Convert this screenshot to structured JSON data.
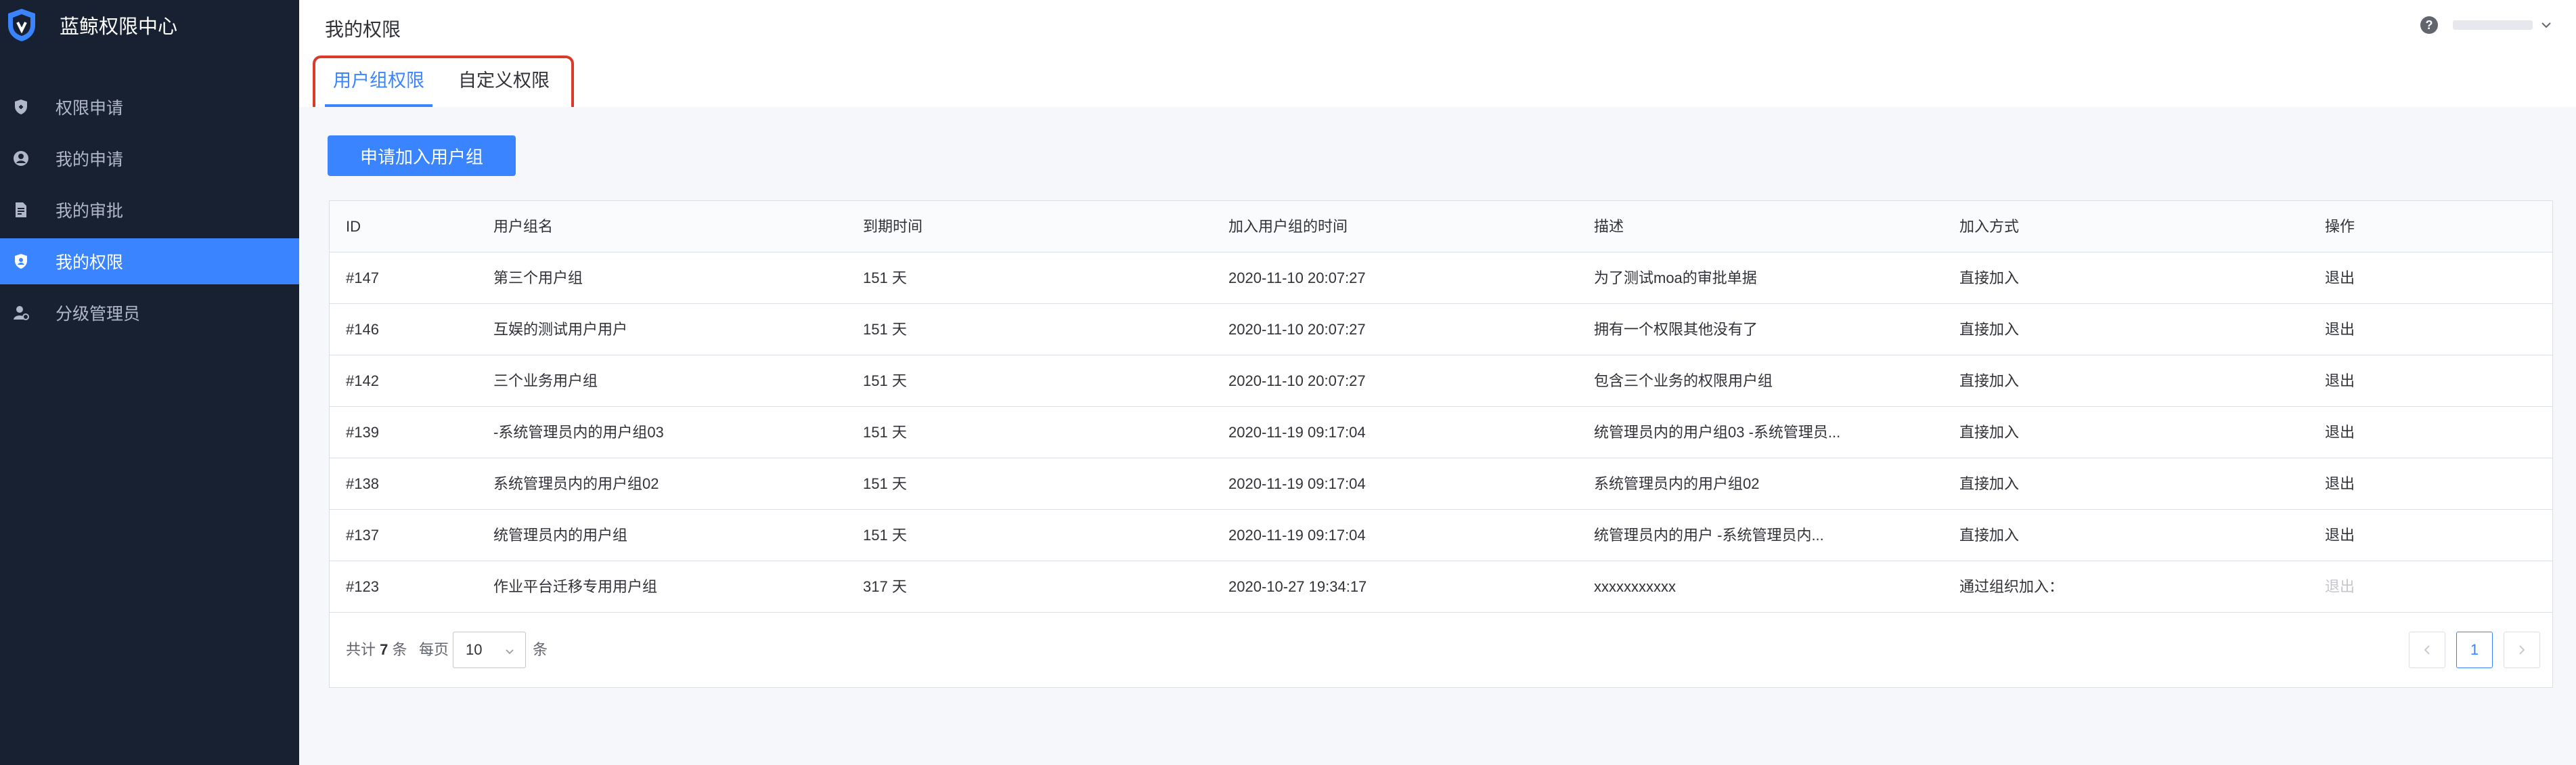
{
  "app": {
    "title": "蓝鲸权限中心"
  },
  "sidebar": {
    "items": [
      {
        "label": "权限申请",
        "icon": "shield-add-icon"
      },
      {
        "label": "我的申请",
        "icon": "user-circle-icon"
      },
      {
        "label": "我的审批",
        "icon": "document-icon"
      },
      {
        "label": "我的权限",
        "icon": "shield-user-icon",
        "active": true
      },
      {
        "label": "分级管理员",
        "icon": "admin-user-icon"
      }
    ]
  },
  "header": {
    "page_title": "我的权限",
    "help": "?"
  },
  "tabs": [
    {
      "label": "用户组权限",
      "active": true
    },
    {
      "label": "自定义权限",
      "active": false
    }
  ],
  "actions": {
    "apply_button": "申请加入用户组"
  },
  "table": {
    "columns": [
      "ID",
      "用户组名",
      "到期时间",
      "加入用户组的时间",
      "描述",
      "加入方式",
      "操作"
    ],
    "rows": [
      {
        "id": "#147",
        "name": "第三个用户组",
        "expire": "151 天",
        "joined": "2020-11-10 20:07:27",
        "desc": "为了测试moa的审批单据",
        "method": "直接加入",
        "action": "退出",
        "action_enabled": true
      },
      {
        "id": "#146",
        "name": "互娱的测试用户用户",
        "expire": "151 天",
        "joined": "2020-11-10 20:07:27",
        "desc": "拥有一个权限其他没有了",
        "method": "直接加入",
        "action": "退出",
        "action_enabled": true
      },
      {
        "id": "#142",
        "name": "三个业务用户组",
        "expire": "151 天",
        "joined": "2020-11-10 20:07:27",
        "desc": "包含三个业务的权限用户组",
        "method": "直接加入",
        "action": "退出",
        "action_enabled": true
      },
      {
        "id": "#139",
        "name": "-系统管理员内的用户组03",
        "expire": "151 天",
        "joined": "2020-11-19 09:17:04",
        "desc": "统管理员内的用户组03 -系统管理员...",
        "method": "直接加入",
        "action": "退出",
        "action_enabled": true
      },
      {
        "id": "#138",
        "name": "系统管理员内的用户组02",
        "expire": "151 天",
        "joined": "2020-11-19 09:17:04",
        "desc": "系统管理员内的用户组02",
        "method": "直接加入",
        "action": "退出",
        "action_enabled": true
      },
      {
        "id": "#137",
        "name": "统管理员内的用户组",
        "expire": "151 天",
        "joined": "2020-11-19 09:17:04",
        "desc": "统管理员内的用户 -系统管理员内...",
        "method": "直接加入",
        "action": "退出",
        "action_enabled": true
      },
      {
        "id": "#123",
        "name": "作业平台迁移专用用户组",
        "expire": "317 天",
        "joined": "2020-10-27 19:34:17",
        "desc": "xxxxxxxxxxx",
        "method": "通过组织加入：",
        "action": "退出",
        "action_enabled": false
      }
    ]
  },
  "footer": {
    "total_prefix": "共计",
    "total_count": "7",
    "total_suffix": "条",
    "per_page_label": "每页",
    "page_size": "10",
    "per_page_unit": "条",
    "current_page": "1"
  },
  "colors": {
    "primary": "#3a84ff",
    "sidebar_bg": "#182132",
    "highlight_frame": "#d93a2b"
  }
}
